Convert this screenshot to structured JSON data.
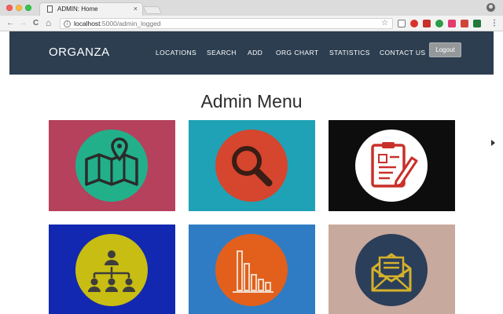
{
  "browser": {
    "tab_title": "ADMIN: Home",
    "tab_close": "×",
    "url_host": "localhost",
    "url_path": ":5000/admin_logged",
    "back": "←",
    "forward": "→",
    "reload": "C",
    "home": "⌂",
    "star": "☆",
    "menu": "⋮"
  },
  "site": {
    "brand": "ORGANZA",
    "nav": [
      "LOCATIONS",
      "SEARCH",
      "ADD",
      "ORG CHART",
      "STATISTICS",
      "CONTACT US"
    ],
    "logout": "Logout"
  },
  "main": {
    "title": "Admin Menu"
  },
  "tiles": [
    {
      "icon": "map-location-icon",
      "bg": "#b5415c",
      "disc": "#22b08a"
    },
    {
      "icon": "search-icon",
      "bg": "#1fa2b5",
      "disc": "#d6452e"
    },
    {
      "icon": "clipboard-edit-icon",
      "bg": "#0d0d0d",
      "disc": "#ffffff"
    },
    {
      "icon": "org-chart-icon",
      "bg": "#1228b0",
      "disc": "#c8bd12"
    },
    {
      "icon": "bar-chart-icon",
      "bg": "#2f7cc4",
      "disc": "#e2601b"
    },
    {
      "icon": "envelope-icon",
      "bg": "#c7a99d",
      "disc": "#2b3e5a"
    }
  ]
}
